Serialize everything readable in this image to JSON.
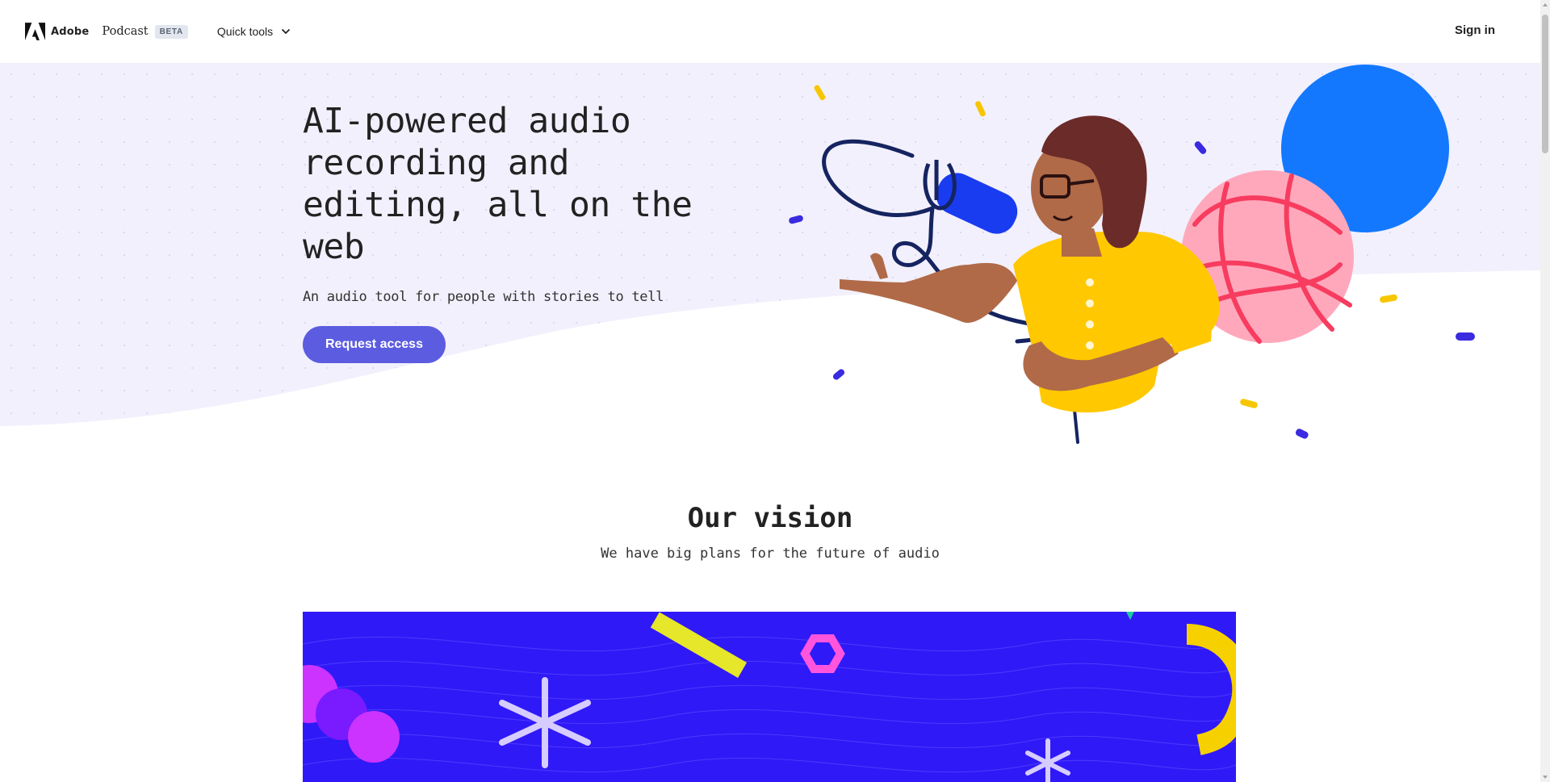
{
  "header": {
    "brand": "Adobe",
    "product": "Podcast",
    "badge": "BETA",
    "quick_tools_label": "Quick tools",
    "sign_in_label": "Sign in"
  },
  "hero": {
    "title": "AI-powered audio recording and editing, all on the web",
    "subtitle": "An audio tool for people with stories to tell",
    "cta_label": "Request access"
  },
  "vision": {
    "title": "Our vision",
    "subtitle": "We have big plans for the future of audio"
  },
  "colors": {
    "accent": "#5c5ce0",
    "hero_background": "#f2f0fc",
    "banner_background": "#3019f7"
  },
  "icons": {
    "logo": "adobe-logo-icon",
    "dropdown": "chevron-down-icon"
  }
}
